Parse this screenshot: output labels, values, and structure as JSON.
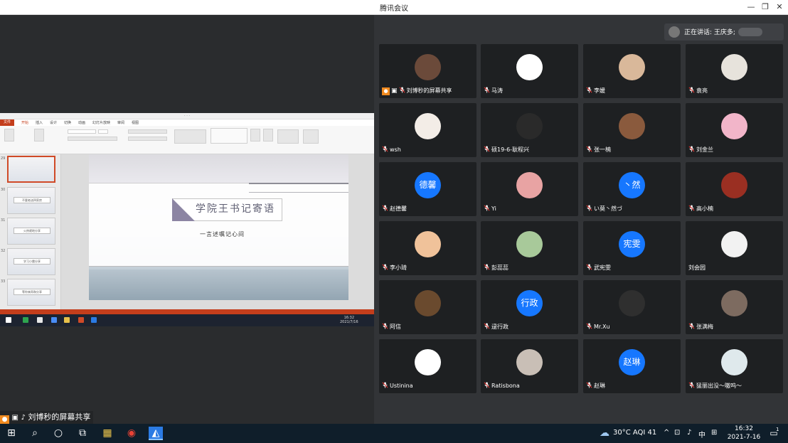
{
  "window": {
    "title": "腾讯会议",
    "minimize": "—",
    "restore": "❐",
    "close": "✕"
  },
  "shared_screen": {
    "ppt_tabs": [
      "文件",
      "开始",
      "插入",
      "设计",
      "切换",
      "动画",
      "幻灯片放映",
      "审阅",
      "视图"
    ],
    "slide_title": "学院王书记寄语",
    "slide_subtitle": "一言述嘱记心间",
    "thumb_numbers": [
      "29",
      "30",
      "31",
      "32",
      "33"
    ],
    "thumb_labels": [
      "",
      "不要老送四家房",
      "火热就地分享",
      "学习小雷分享",
      "等你来再和分享"
    ],
    "mini_time": "16:32",
    "mini_date": "2021/7/16"
  },
  "sharer_label": "刘博秒的屏幕共享",
  "speaking": {
    "label": "正在讲话: 王庆多;"
  },
  "participants": [
    {
      "name": "刘博秒的屏幕共享",
      "avatar_type": "image",
      "avatar_color": "#6b4a3a",
      "sharing": true
    },
    {
      "name": "马涛",
      "avatar_type": "image",
      "avatar_color": "#ffffff"
    },
    {
      "name": "李媛",
      "avatar_type": "image",
      "avatar_color": "#d9b89a"
    },
    {
      "name": "袁亮",
      "avatar_type": "image",
      "avatar_color": "#e7e3dc"
    },
    {
      "name": "wsh",
      "avatar_type": "image",
      "avatar_color": "#f3ede7"
    },
    {
      "name": "硕19-6-耿程兴",
      "avatar_type": "image",
      "avatar_color": "#2a2a2a"
    },
    {
      "name": "张一楠",
      "avatar_type": "image",
      "avatar_color": "#8a5a3d"
    },
    {
      "name": "刘金兰",
      "avatar_type": "image",
      "avatar_color": "#f2b5c9"
    },
    {
      "name": "赵德馨",
      "avatar_type": "text",
      "avatar_text": "德馨",
      "avatar_color": "#1677ff"
    },
    {
      "name": "Yi",
      "avatar_type": "image",
      "avatar_color": "#e8a3a3"
    },
    {
      "name": "い莫丶然づ",
      "avatar_type": "text",
      "avatar_text": "丶然",
      "avatar_color": "#1677ff"
    },
    {
      "name": "高小楠",
      "avatar_type": "image",
      "avatar_color": "#9a2f22"
    },
    {
      "name": "李小琦",
      "avatar_type": "image",
      "avatar_color": "#f0c29a"
    },
    {
      "name": "彭蕊蕊",
      "avatar_type": "image",
      "avatar_color": "#a8c99a"
    },
    {
      "name": "武宪雯",
      "avatar_type": "text",
      "avatar_text": "宪雯",
      "avatar_color": "#1677ff"
    },
    {
      "name": "刘会园",
      "avatar_type": "image",
      "avatar_color": "#f2f2f2",
      "no_mic": true
    },
    {
      "name": "阿信",
      "avatar_type": "image",
      "avatar_color": "#6a4a2e"
    },
    {
      "name": "逯行政",
      "avatar_type": "text",
      "avatar_text": "行政",
      "avatar_color": "#1677ff"
    },
    {
      "name": "Mr.Xu",
      "avatar_type": "image",
      "avatar_color": "#2f2f2f"
    },
    {
      "name": "张满梅",
      "avatar_type": "image",
      "avatar_color": "#7d6b60"
    },
    {
      "name": "Ustinina",
      "avatar_type": "image",
      "avatar_color": "#ffffff"
    },
    {
      "name": "Ratisbona",
      "avatar_type": "image",
      "avatar_color": "#c9bfb6"
    },
    {
      "name": "赵琳",
      "avatar_type": "text",
      "avatar_text": "赵琳",
      "avatar_color": "#1677ff"
    },
    {
      "name": "猛丽出没～嗷呜～",
      "avatar_type": "image",
      "avatar_color": "#dfe9ec"
    }
  ],
  "taskbar": {
    "weather": "30°C AQI 41",
    "ime": "中",
    "time": "16:32",
    "date": "2021-7-16",
    "notify_count": "1"
  }
}
